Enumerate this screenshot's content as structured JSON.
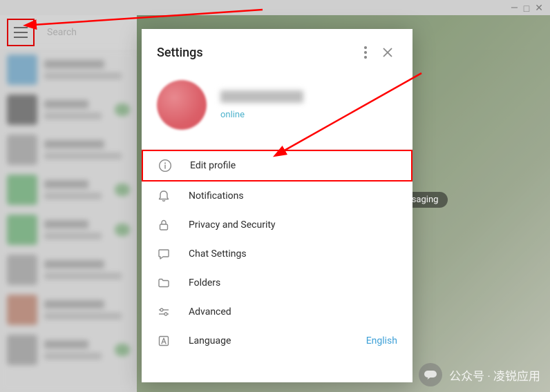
{
  "window_controls": {
    "minimize": "—",
    "maximize": "□",
    "close": "✕"
  },
  "topbar": {
    "search_placeholder": "Search"
  },
  "main_backdrop": {
    "bubble_text": "ssaging"
  },
  "settings": {
    "title": "Settings",
    "status": "online",
    "menu": {
      "edit_profile": "Edit profile",
      "notifications": "Notifications",
      "privacy": "Privacy and Security",
      "chat": "Chat Settings",
      "folders": "Folders",
      "advanced": "Advanced",
      "language": "Language",
      "language_value": "English"
    }
  },
  "watermark": {
    "text": "公众号 · 凌锐应用"
  },
  "chat_list_demo": [
    {
      "c": "#4aa3d9"
    },
    {
      "c": "#3a3a3a"
    },
    {
      "c": "#a0a0a0"
    },
    {
      "c": "#4bb35a"
    },
    {
      "c": "#4bb35a"
    },
    {
      "c": "#a0a0a0"
    },
    {
      "c": "#c36a4c"
    },
    {
      "c": "#999"
    }
  ]
}
